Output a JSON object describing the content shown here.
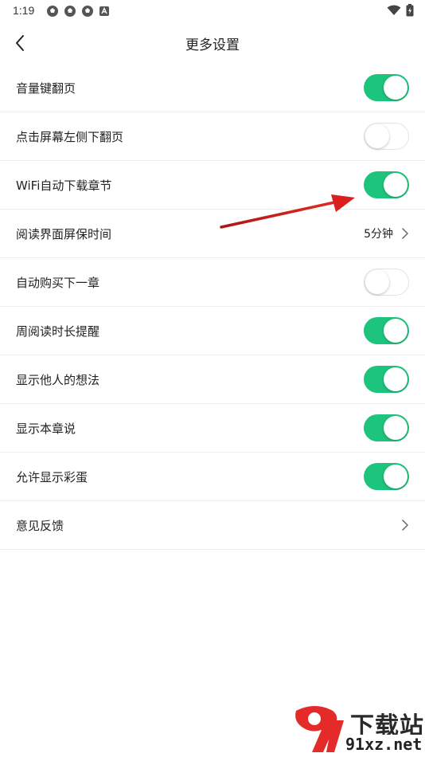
{
  "status": {
    "time": "1:19",
    "left_icons": [
      "soccer-ball-icon",
      "soccer-ball-icon",
      "soccer-ball-icon",
      "notification-a-icon"
    ],
    "right_icons": [
      "wifi-icon",
      "battery-charging-icon"
    ]
  },
  "header": {
    "title": "更多设置",
    "back_icon": "chevron-left-icon"
  },
  "colors": {
    "toggle_on": "#1dc47b",
    "annotation_arrow": "#d9201f"
  },
  "settings": [
    {
      "label": "音量键翻页",
      "type": "toggle",
      "on": true
    },
    {
      "label": "点击屏幕左侧下翻页",
      "type": "toggle",
      "on": false
    },
    {
      "label": "WiFi自动下载章节",
      "type": "toggle",
      "on": true
    },
    {
      "label": "阅读界面屏保时间",
      "type": "link",
      "value": "5分钟"
    },
    {
      "label": "自动购买下一章",
      "type": "toggle",
      "on": false
    },
    {
      "label": "周阅读时长提醒",
      "type": "toggle",
      "on": true
    },
    {
      "label": "显示他人的想法",
      "type": "toggle",
      "on": true
    },
    {
      "label": "显示本章说",
      "type": "toggle",
      "on": true
    },
    {
      "label": "允许显示彩蛋",
      "type": "toggle",
      "on": true
    },
    {
      "label": "意见反馈",
      "type": "link",
      "value": ""
    }
  ],
  "watermark": {
    "top": "下载站",
    "bottom": "91xz.net"
  }
}
